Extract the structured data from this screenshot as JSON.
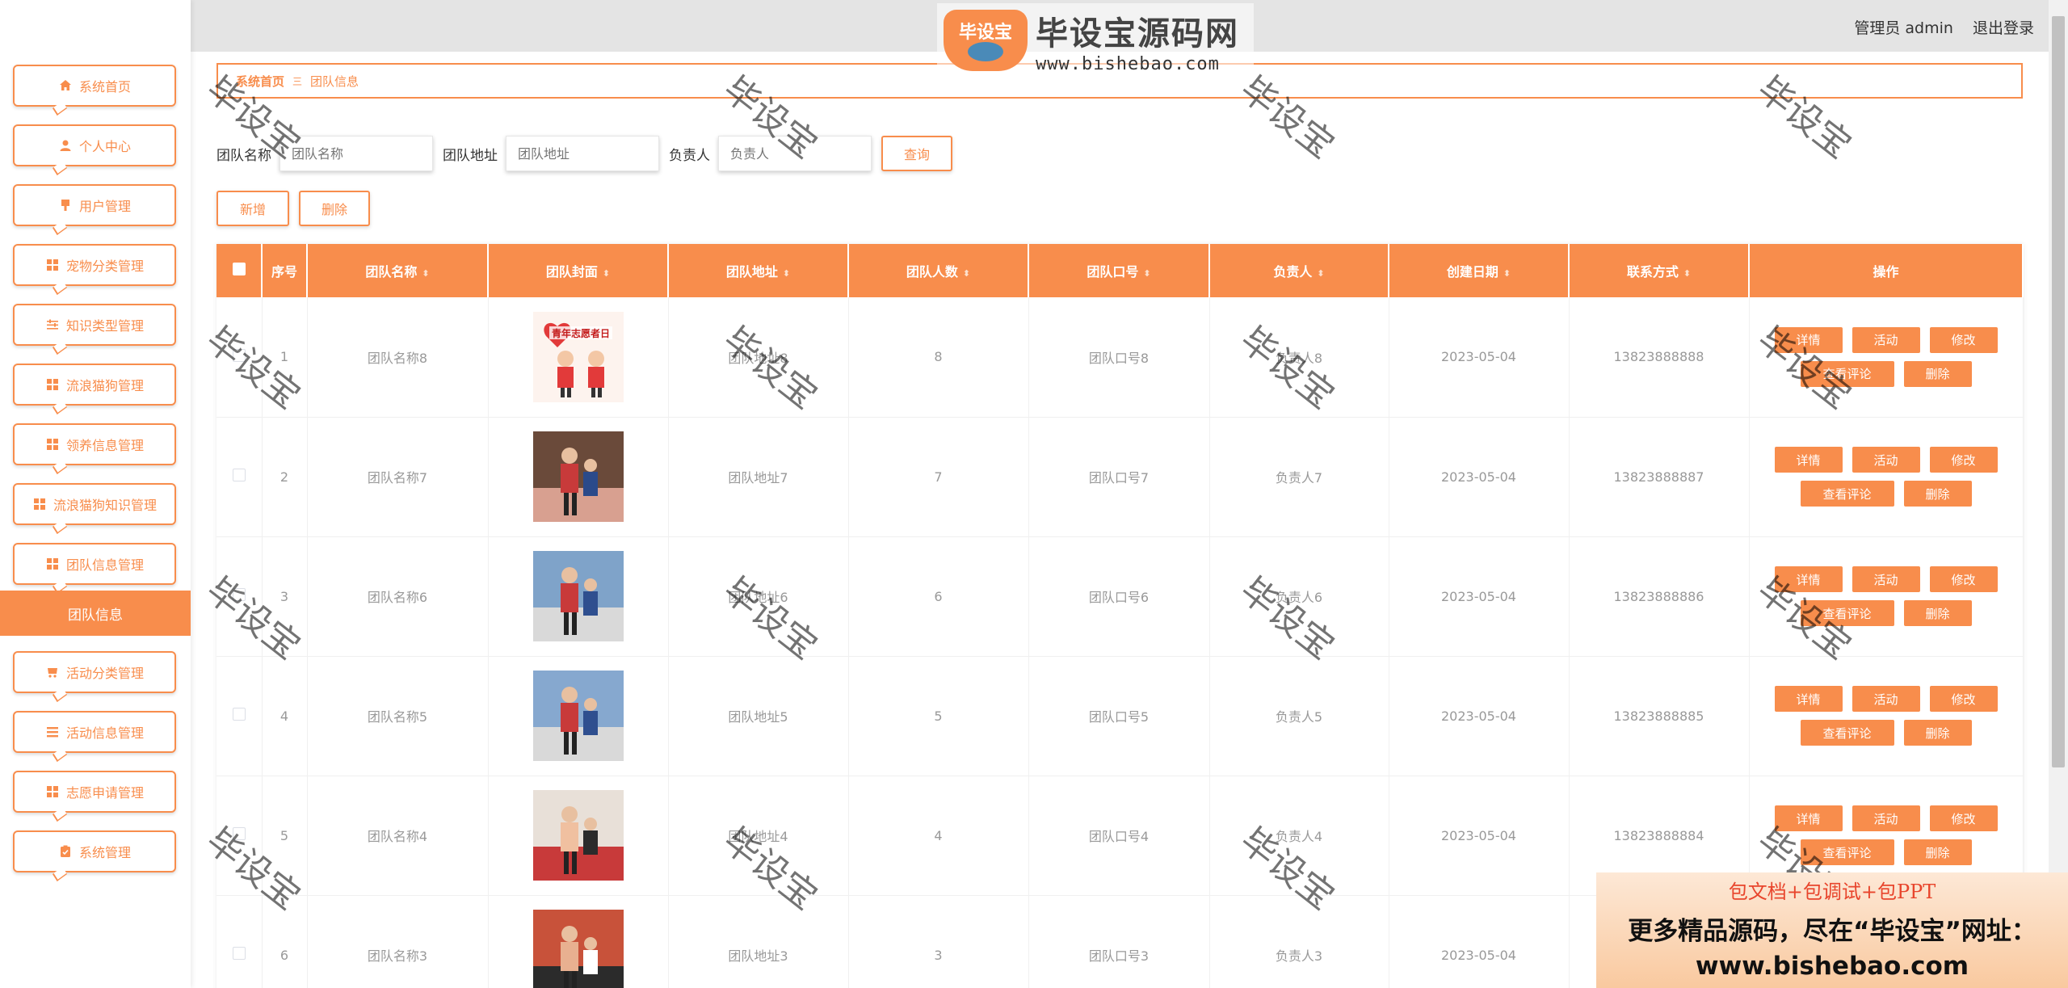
{
  "header": {
    "user_role": "管理员 admin",
    "logout": "退出登录",
    "logo_badge": "毕设宝",
    "logo_title": "毕设宝源码网",
    "logo_url": "www.bishebao.com"
  },
  "sidebar": {
    "items": [
      {
        "label": "系统首页",
        "icon": "home-icon"
      },
      {
        "label": "个人中心",
        "icon": "user-icon"
      },
      {
        "label": "用户管理",
        "icon": "user-manage-icon"
      },
      {
        "label": "宠物分类管理",
        "icon": "grid-icon"
      },
      {
        "label": "知识类型管理",
        "icon": "sliders-icon"
      },
      {
        "label": "流浪猫狗管理",
        "icon": "grid-icon"
      },
      {
        "label": "领养信息管理",
        "icon": "grid-icon"
      },
      {
        "label": "流浪猫狗知识管理",
        "icon": "grid-icon"
      },
      {
        "label": "团队信息管理",
        "icon": "grid-icon"
      },
      {
        "label": "活动分类管理",
        "icon": "cart-icon"
      },
      {
        "label": "活动信息管理",
        "icon": "list-icon"
      },
      {
        "label": "志愿申请管理",
        "icon": "grid-icon"
      },
      {
        "label": "系统管理",
        "icon": "clipboard-icon"
      }
    ],
    "active_sub": "团队信息"
  },
  "breadcrumb": {
    "home": "系统首页",
    "separator": "三",
    "current": "团队信息"
  },
  "search": {
    "name_label": "团队名称",
    "name_placeholder": "团队名称",
    "address_label": "团队地址",
    "address_placeholder": "团队地址",
    "leader_label": "负责人",
    "leader_placeholder": "负责人",
    "query_button": "查询"
  },
  "actions": {
    "add": "新增",
    "delete": "删除"
  },
  "table": {
    "columns": [
      "序号",
      "团队名称",
      "团队封面",
      "团队地址",
      "团队人数",
      "团队口号",
      "负责人",
      "创建日期",
      "联系方式",
      "操作"
    ],
    "rows": [
      {
        "index": "1",
        "name": "团队名称8",
        "address": "团队地址8",
        "count": "8",
        "slogan": "团队口号8",
        "leader": "负责人8",
        "date": "2023-05-04",
        "phone": "13823888888",
        "cover_text": "青年志愿者日"
      },
      {
        "index": "2",
        "name": "团队名称7",
        "address": "团队地址7",
        "count": "7",
        "slogan": "团队口号7",
        "leader": "负责人7",
        "date": "2023-05-04",
        "phone": "13823888887"
      },
      {
        "index": "3",
        "name": "团队名称6",
        "address": "团队地址6",
        "count": "6",
        "slogan": "团队口号6",
        "leader": "负责人6",
        "date": "2023-05-04",
        "phone": "13823888886"
      },
      {
        "index": "4",
        "name": "团队名称5",
        "address": "团队地址5",
        "count": "5",
        "slogan": "团队口号5",
        "leader": "负责人5",
        "date": "2023-05-04",
        "phone": "13823888885"
      },
      {
        "index": "5",
        "name": "团队名称4",
        "address": "团队地址4",
        "count": "4",
        "slogan": "团队口号4",
        "leader": "负责人4",
        "date": "2023-05-04",
        "phone": "13823888884"
      },
      {
        "index": "6",
        "name": "团队名称3",
        "address": "团队地址3",
        "count": "3",
        "slogan": "团队口号3",
        "leader": "负责人3",
        "date": "2023-05-04",
        "phone": ""
      }
    ],
    "op_labels": {
      "detail": "详情",
      "activity": "活动",
      "edit": "修改",
      "comments": "查看评论",
      "delete": "删除"
    }
  },
  "watermark": "毕设宝",
  "promo": {
    "line1": "包文档+包调试+包PPT",
    "line2": "更多精品源码，尽在“毕设宝”网址：",
    "line3": "www.bishebao.com"
  },
  "colors": {
    "accent": "#f88d4c",
    "header_bg": "#e4e4e4"
  }
}
